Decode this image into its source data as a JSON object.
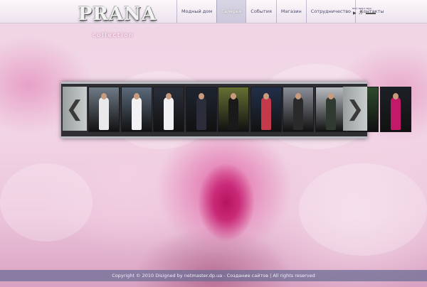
{
  "brand": {
    "logo_text": "PRANA",
    "logo_sub": "collection"
  },
  "menu": {
    "items": [
      {
        "label": "Модный дом",
        "active": false
      },
      {
        "label": "Галерея",
        "active": true
      },
      {
        "label": "События",
        "active": false
      },
      {
        "label": "Магазин",
        "active": false
      },
      {
        "label": "Сотрудничество",
        "active": false
      },
      {
        "label": "Контакты",
        "active": false
      }
    ]
  },
  "player": {
    "label": "вкл/ выкл звук",
    "play_icon": "play-icon",
    "volume_icon": "speaker-icon"
  },
  "gallery": {
    "prev_icon": "chevron-left-icon",
    "next_icon": "chevron-right-icon",
    "thumbs": [
      {
        "bg": "#6f7a86",
        "outfit": "#e9e9ec"
      },
      {
        "bg": "#5b6a7c",
        "outfit": "#f2f2f4"
      },
      {
        "bg": "#2a2f3a",
        "outfit": "#f1f1f3"
      },
      {
        "bg": "#1e2530",
        "outfit": "#2b2d3a"
      },
      {
        "bg": "#657032",
        "outfit": "#1a1a1a"
      },
      {
        "bg": "#23304a",
        "outfit": "#c53a4a"
      },
      {
        "bg": "#8a8e98",
        "outfit": "#2a2a2a"
      },
      {
        "bg": "#b8bcc2",
        "outfit": "#2f3a30"
      },
      {
        "bg": "#2e4a2b",
        "outfit": "#1e2a20"
      },
      {
        "bg": "#1d2026",
        "outfit": "#c2196a"
      }
    ]
  },
  "footer": {
    "text": "Copyright © 2010 Disigned by netmaster.dp.ua - Создание сайтов | All rights reserved"
  }
}
